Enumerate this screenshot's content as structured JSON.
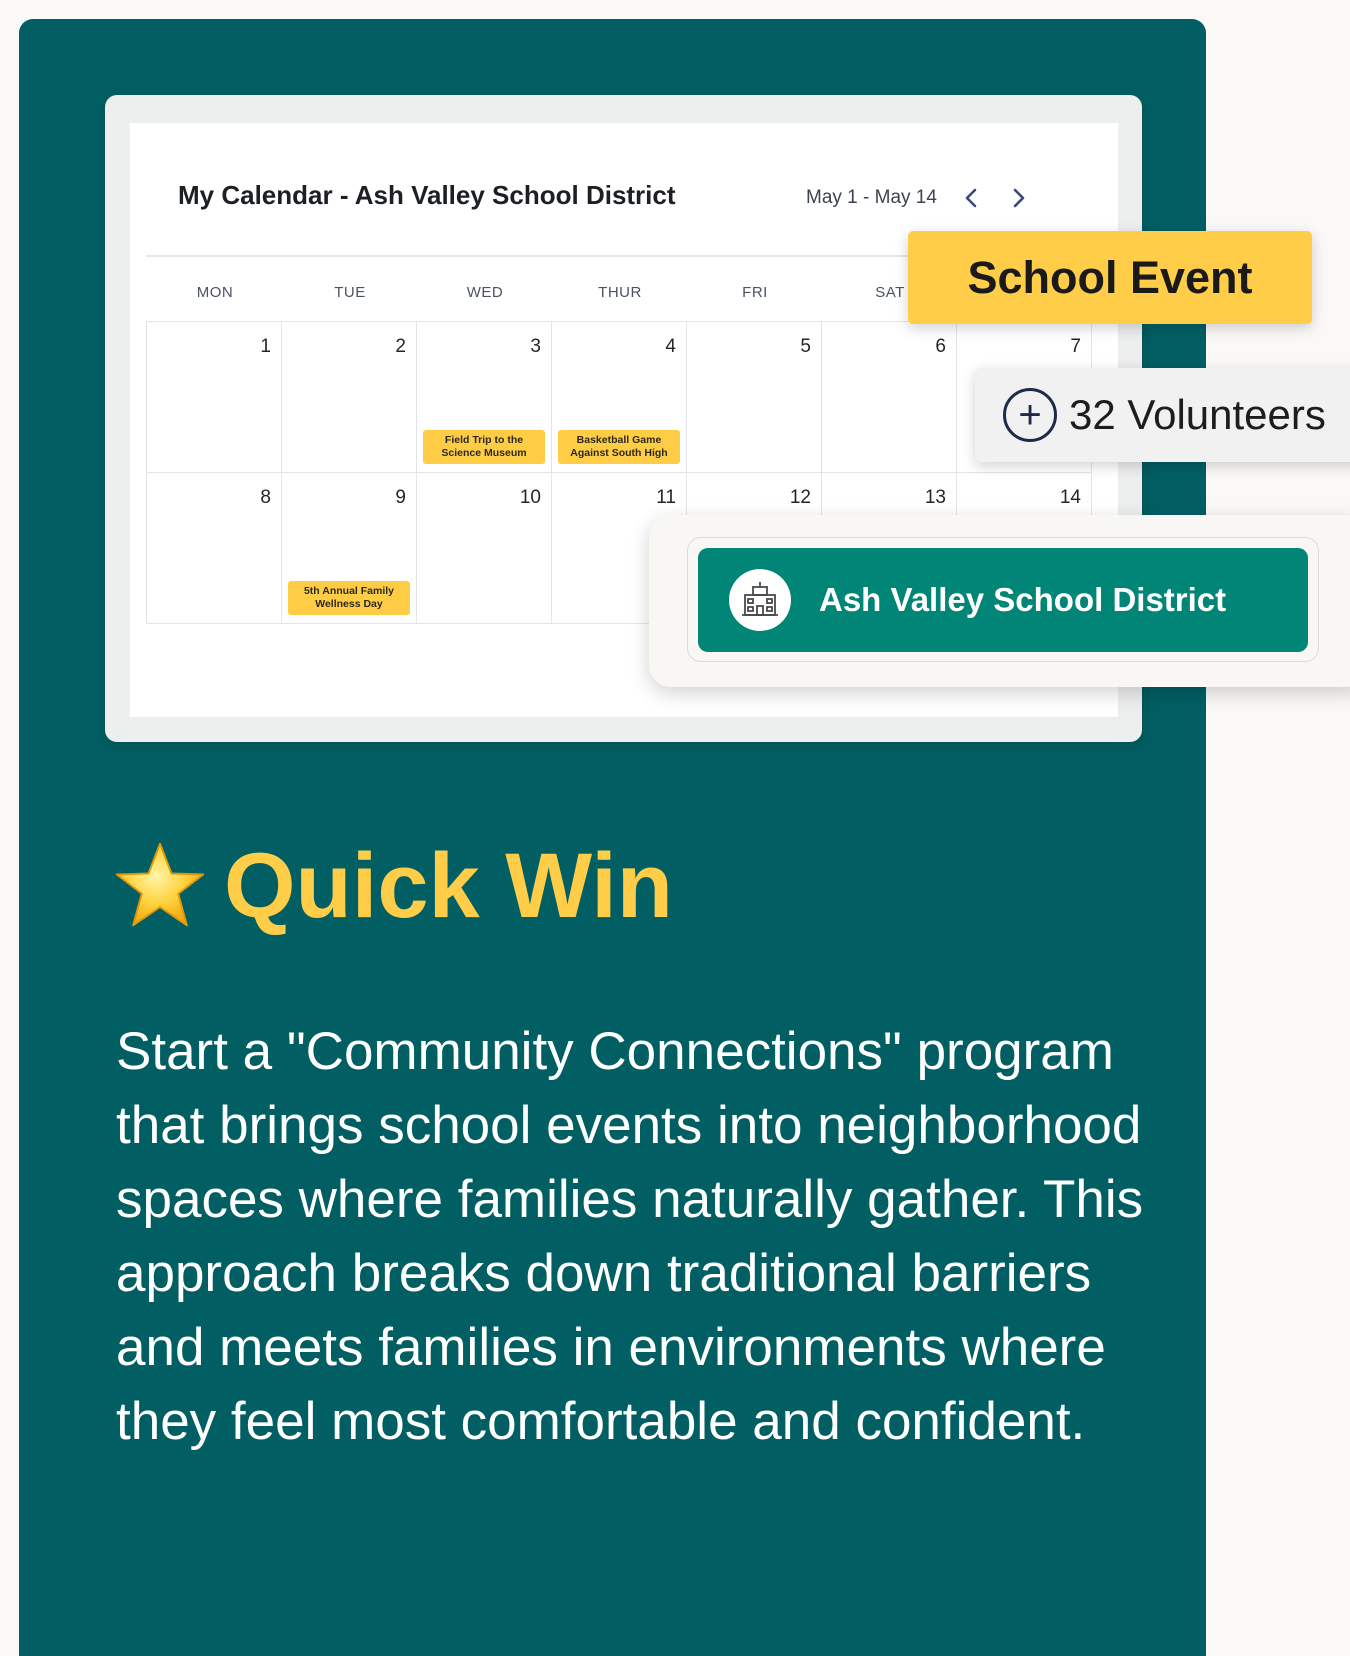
{
  "calendar": {
    "title": "My Calendar - Ash Valley School District",
    "range": "May 1 - May 14",
    "prev_icon": "chevron-left-icon",
    "next_icon": "chevron-right-icon",
    "weekdays": [
      "MON",
      "TUE",
      "WED",
      "THUR",
      "FRI",
      "SAT"
    ],
    "days": [
      "1",
      "2",
      "3",
      "4",
      "5",
      "6",
      "7",
      "8",
      "9",
      "10",
      "11",
      "12",
      "13",
      "14"
    ],
    "events": {
      "day3": "Field Trip to the Science Museum",
      "day4": "Basketball Game Against South High",
      "day9": "5th Annual Family Wellness Day"
    }
  },
  "tags": {
    "school_event": "School Event",
    "volunteers": "32 Volunteers",
    "volunteers_icon": "plus-circle-icon"
  },
  "district": {
    "name": "Ash Valley School District",
    "icon": "school-building-icon"
  },
  "quick_win": {
    "icon": "star-icon",
    "title": "Quick Win",
    "body": "Start a \"Community Connections\" program that brings school events into neighborhood spaces where families naturally gather. This approach breaks down traditional barriers and meets families in environments where they feel most comfortable and confident."
  },
  "colors": {
    "background": "#fbf9f6",
    "card": "#015f63",
    "accent_yellow": "#ffcd48",
    "district_green": "#008576"
  }
}
